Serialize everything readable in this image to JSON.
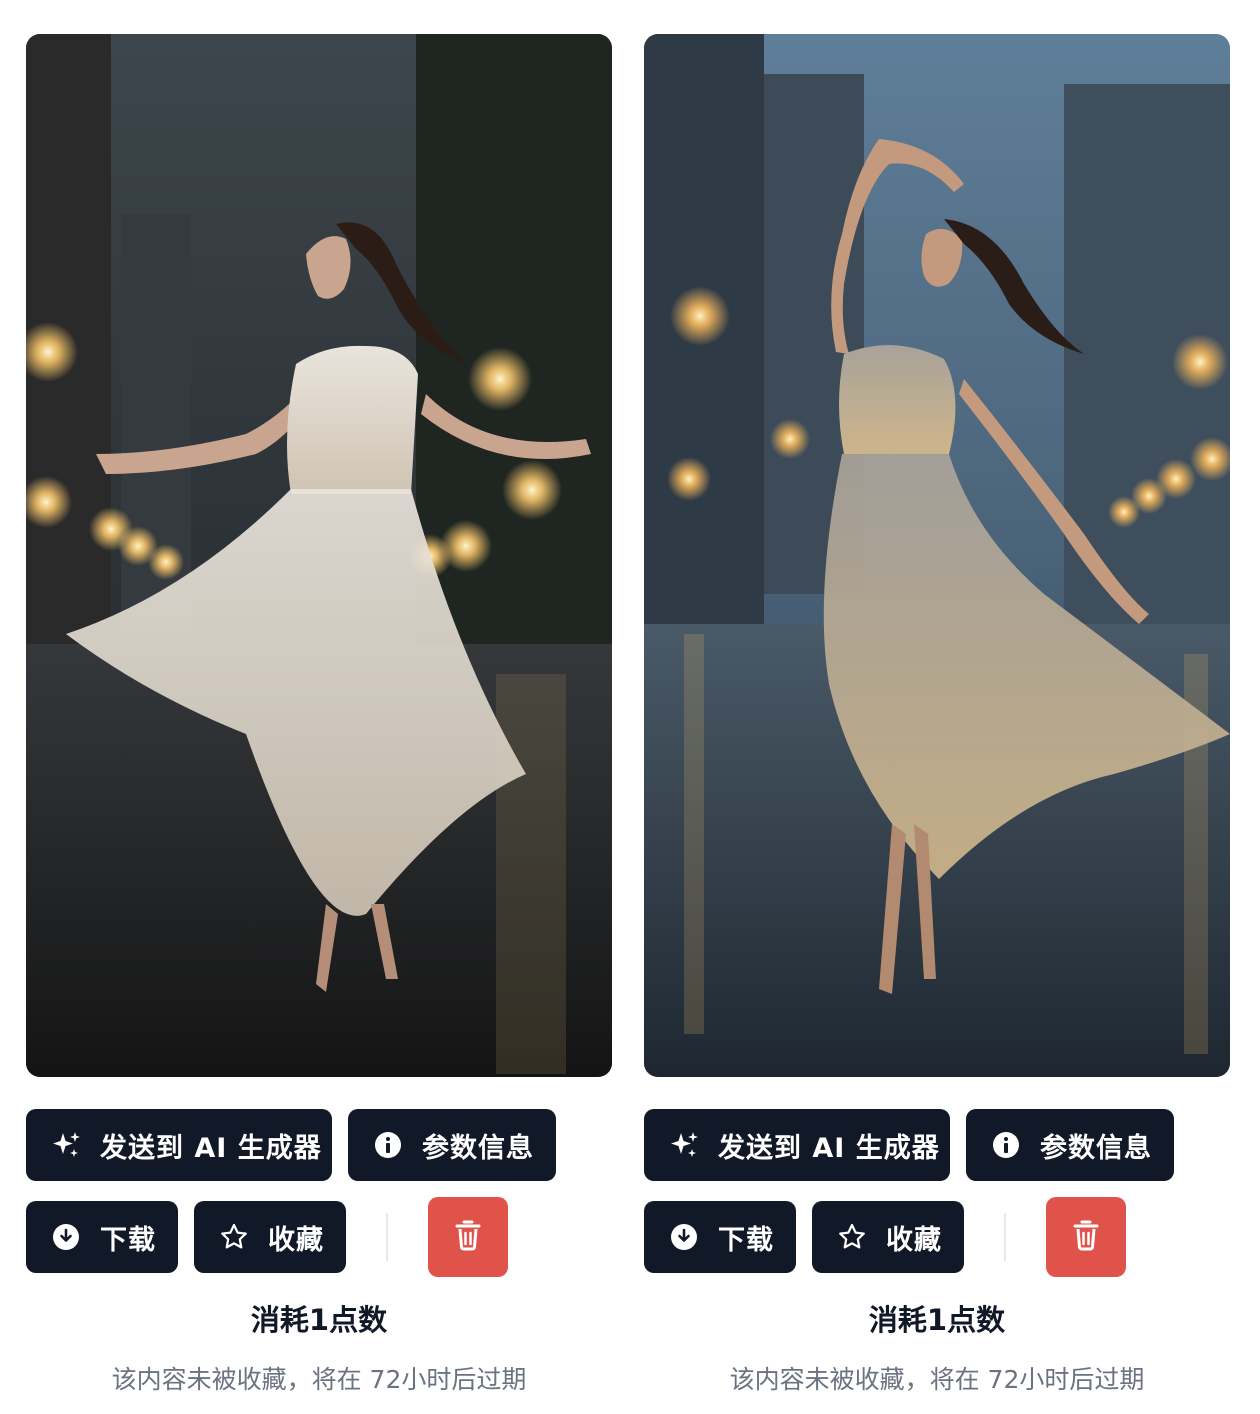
{
  "cards": [
    {
      "image_alt": "Woman in white flowing dress dancing barefoot on a rainy city street at night",
      "buttons": {
        "send_label": "发送到 AI 生成器",
        "info_label": "参数信息",
        "download_label": "下载",
        "favorite_label": "收藏"
      },
      "cost_text": "消耗1点数",
      "expire_text": "该内容未被收藏，将在 72小时后过期"
    },
    {
      "image_alt": "Woman in silver dress dancing in heels with arm raised on a rainy city street",
      "buttons": {
        "send_label": "发送到 AI 生成器",
        "info_label": "参数信息",
        "download_label": "下载",
        "favorite_label": "收藏"
      },
      "cost_text": "消耗1点数",
      "expire_text": "该内容未被收藏，将在 72小时后过期"
    }
  ],
  "icons": {
    "send": "sparkles-icon",
    "info": "info-circle-icon",
    "download": "download-circle-icon",
    "favorite": "star-icon",
    "delete": "trash-icon"
  },
  "colors": {
    "button_bg": "#111827",
    "delete_bg": "#e0534a",
    "muted_text": "#6b7280"
  }
}
